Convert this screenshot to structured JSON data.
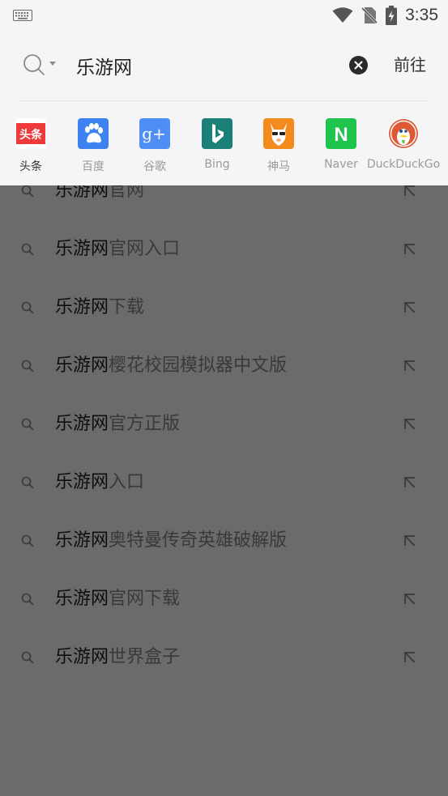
{
  "status_bar": {
    "time": "3:35",
    "icons": [
      "keyboard-icon",
      "wifi-icon",
      "no-sim-icon",
      "battery-charging-icon"
    ]
  },
  "search": {
    "query": "乐游网",
    "go_label": "前往",
    "icons": [
      "search-icon",
      "chevron-down-icon",
      "clear-icon"
    ]
  },
  "engines": [
    {
      "label": "头条",
      "logo_text": "头条",
      "color": "#ee3a3a",
      "active": true
    },
    {
      "label": "百度",
      "color": "#3d82f0"
    },
    {
      "label": "谷歌",
      "logo_text": "g+",
      "color": "#4f8ef5"
    },
    {
      "label": "Bing",
      "color": "#1a8078"
    },
    {
      "label": "神马",
      "color": "#f28a1d"
    },
    {
      "label": "Naver",
      "logo_text": "N",
      "color": "#1fc44c"
    },
    {
      "label": "DuckDuckGo",
      "color": "#de5833"
    }
  ],
  "suggestions": [
    {
      "query": "乐游网",
      "suffix": "官网"
    },
    {
      "query": "乐游网",
      "suffix": "官网入口"
    },
    {
      "query": "乐游网",
      "suffix": "下载"
    },
    {
      "query": "乐游网",
      "suffix": "樱花校园模拟器中文版"
    },
    {
      "query": "乐游网",
      "suffix": "官方正版"
    },
    {
      "query": "乐游网",
      "suffix": "入口"
    },
    {
      "query": "乐游网",
      "suffix": "奥特曼传奇英雄破解版"
    },
    {
      "query": "乐游网",
      "suffix": "官网下载"
    },
    {
      "query": "乐游网",
      "suffix": "世界盒子"
    }
  ]
}
